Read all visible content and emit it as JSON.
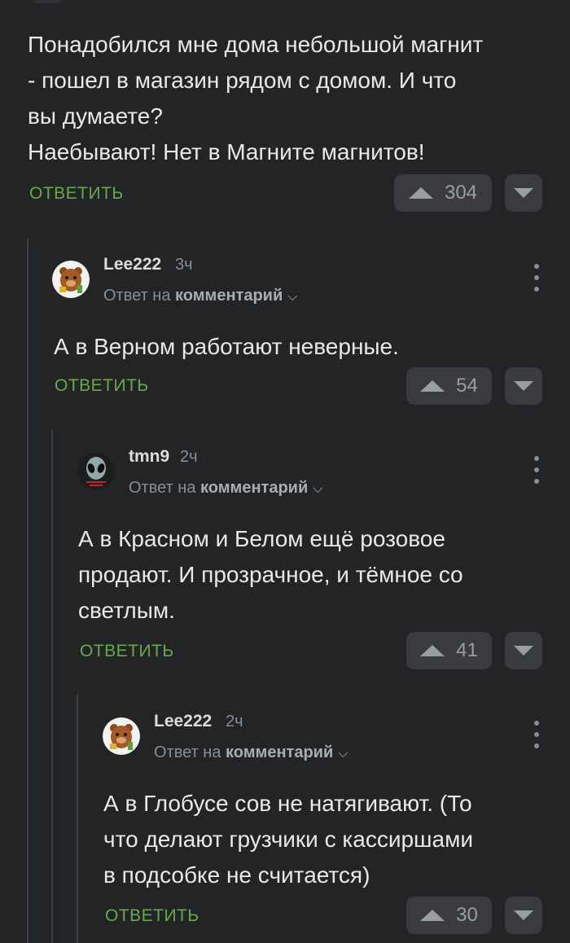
{
  "comments": [
    {
      "text": "Понадобился мне дома небольшой магнит\n- пошел в магазин рядом с домом. И что\nвы думаете?\nНаебывают! Нет в Магните магнитов!",
      "reply_label": "ОТВЕТИТЬ",
      "votes": "304"
    },
    {
      "username": "Lee222",
      "time": "3ч",
      "reply_to_prefix": "Ответ на",
      "reply_to_target": "комментарий",
      "text": "А в Верном работают неверные.",
      "reply_label": "ОТВЕТИТЬ",
      "votes": "54"
    },
    {
      "username": "tmn9",
      "time": "2ч",
      "reply_to_prefix": "Ответ на",
      "reply_to_target": "комментарий",
      "text": "А в Красном и Белом ещё розовое\nпродают. И прозрачное, и тёмное со\nсветлым.",
      "reply_label": "ОТВЕТИТЬ",
      "votes": "41"
    },
    {
      "username": "Lee222",
      "time": "2ч",
      "reply_to_prefix": "Ответ на",
      "reply_to_target": "комментарий",
      "text": "А в Глобусе сов не натягивают. (То\nчто делают грузчики с кассиршами\nв подсобке не считается)",
      "reply_label": "ОТВЕТИТЬ",
      "votes": "30"
    }
  ],
  "colors": {
    "background": "#222426",
    "reply_link": "#6aa84f",
    "vote_button": "#393b3e"
  },
  "icons": {
    "upvote": "triangle-up-icon",
    "downvote": "triangle-down-icon",
    "more": "vertical-dots-icon",
    "chevron": "chevron-down-icon"
  }
}
